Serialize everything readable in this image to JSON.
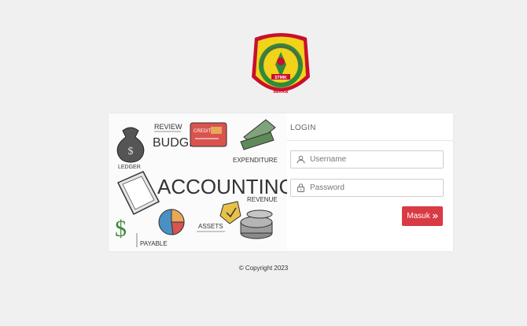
{
  "header": {
    "logo_icon": "stmik-bani-saleh-bekasi-emblem",
    "logo_text": {
      "ring": "SEKOLAH TINGGI MANAJEMEN INFORMATIKA DAN KOMPUTER",
      "center": "STMIK",
      "sub": "BANI SALEH",
      "bottom": "BEKASI"
    }
  },
  "illustration": {
    "main_word": "ACCOUNTING",
    "review": "REVIEW",
    "budget": "BUDGET",
    "credit": "CREDIT",
    "ledger": "LEDGER",
    "expenditure": "EXPENDITURE",
    "revenue": "REVENUE",
    "assets": "ASSETS",
    "payable": "PAYABLE"
  },
  "login": {
    "title": "LOGIN",
    "username_placeholder": "Username",
    "password_placeholder": "Password",
    "submit_label": "Masuk",
    "submit_icon": "double-chevron-right-icon"
  },
  "footer": {
    "copyright": "© Copyright 2023"
  },
  "colors": {
    "background": "#f0f0f0",
    "button": "#d93a44",
    "logo_yellow": "#f2d21b",
    "logo_red": "#c8102e",
    "logo_green": "#2e8b3d"
  }
}
